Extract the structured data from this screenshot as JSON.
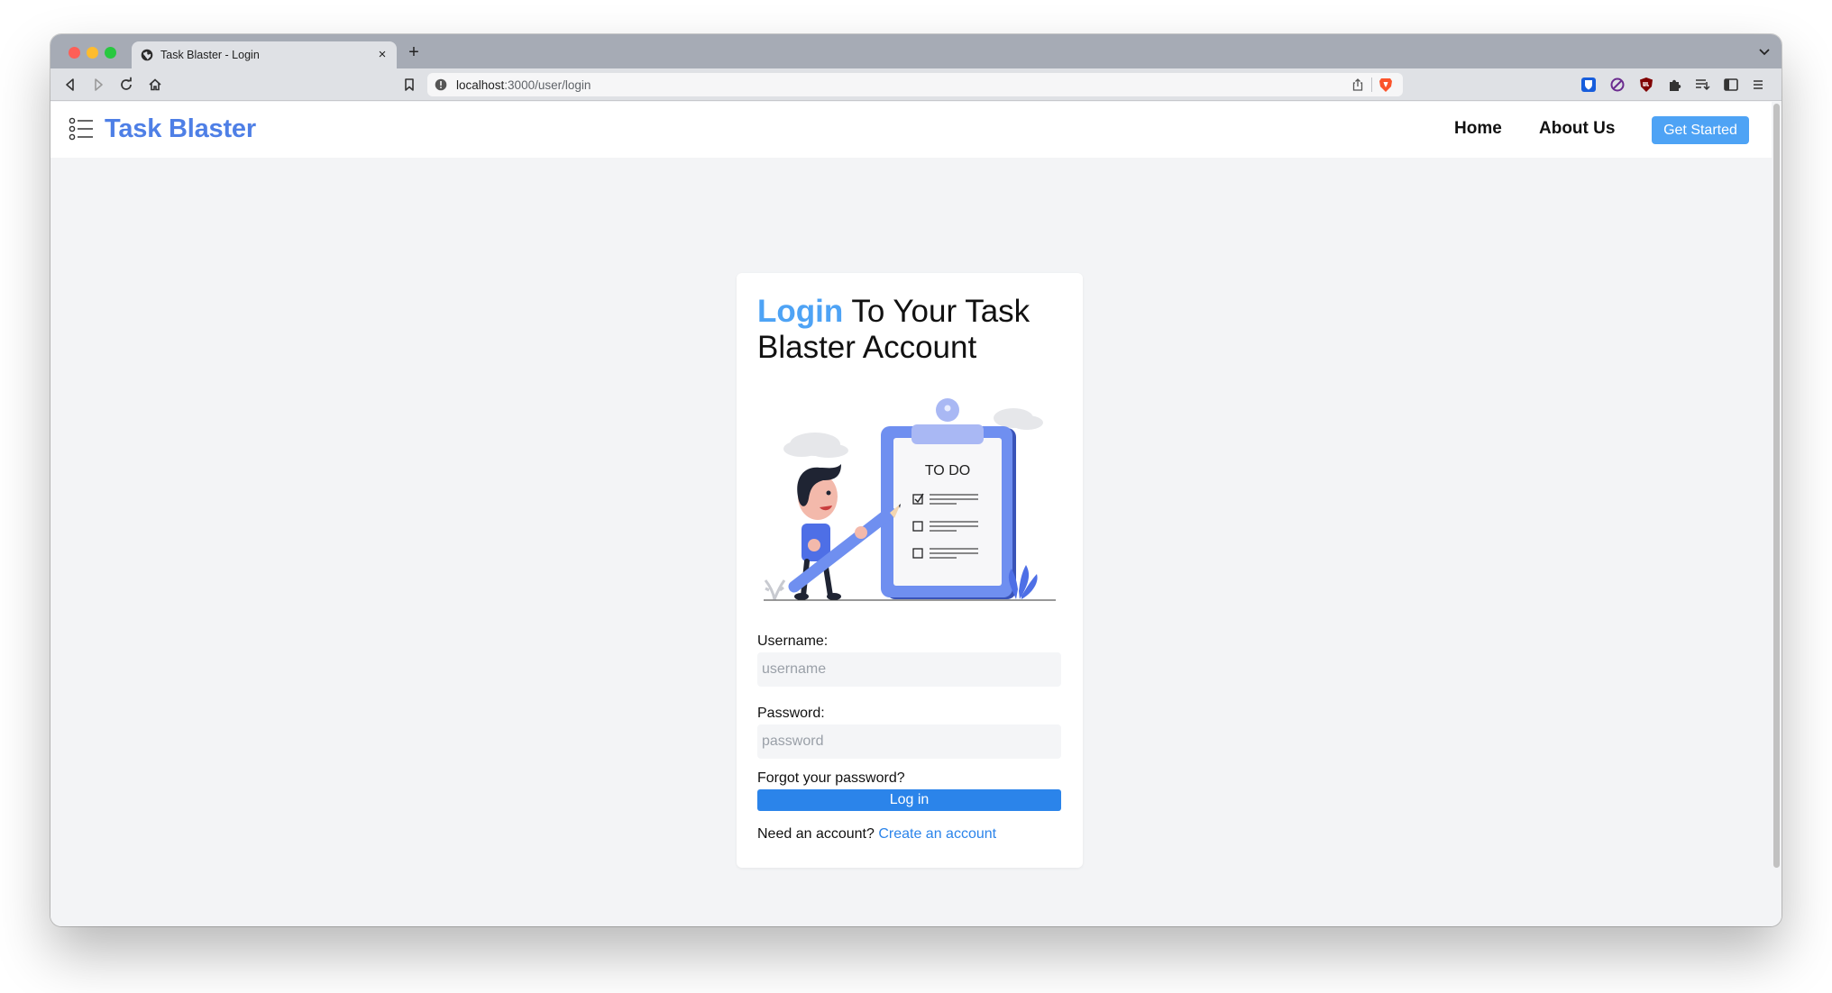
{
  "browser": {
    "tab_title": "Task Blaster - Login",
    "tab_close": "×",
    "new_tab": "+",
    "url_host": "localhost",
    "url_path": ":3000/user/login"
  },
  "navbar": {
    "brand": "Task Blaster",
    "home": "Home",
    "about": "About Us",
    "cta": "Get Started"
  },
  "login": {
    "title_accent": "Login",
    "title_rest": " To Your Task Blaster Account",
    "illustration_text": "TO DO",
    "username_label": "Username:",
    "username_placeholder": "username",
    "password_label": "Password:",
    "password_placeholder": "password",
    "forgot": "Forgot your password?",
    "submit": "Log in",
    "signup_prompt": "Need an account?",
    "signup_link": "Create an account"
  },
  "colors": {
    "brand": "#4e7fe6",
    "accent": "#4ea3f5",
    "primary_button": "#2b84ea"
  }
}
